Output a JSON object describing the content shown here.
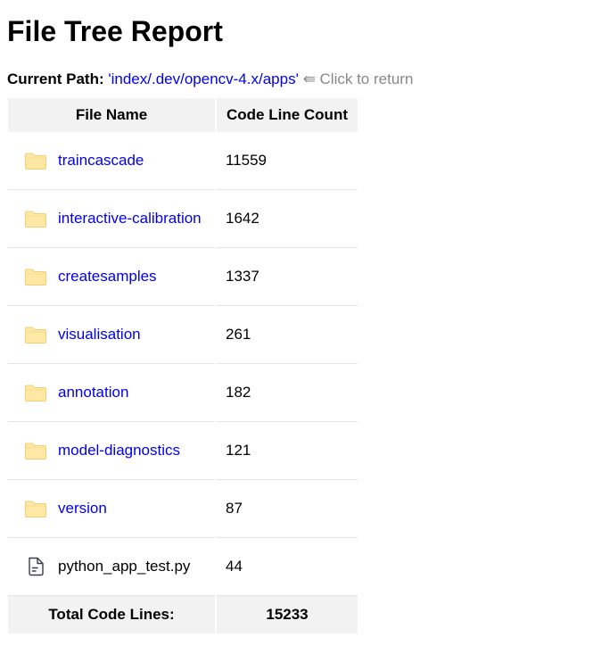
{
  "title": "File Tree Report",
  "current_path": {
    "label": "Current Path:",
    "path": "'index/.dev/opencv-4.x/apps'",
    "return_text": "⇚ Click to return"
  },
  "table": {
    "headers": {
      "name": "File Name",
      "count": "Code Line Count"
    },
    "rows": [
      {
        "icon": "folder-icon",
        "name": "traincascade",
        "count": "11559",
        "is_link": true
      },
      {
        "icon": "folder-icon",
        "name": "interactive-calibration",
        "count": "1642",
        "is_link": true
      },
      {
        "icon": "folder-icon",
        "name": "createsamples",
        "count": "1337",
        "is_link": true
      },
      {
        "icon": "folder-icon",
        "name": "visualisation",
        "count": "261",
        "is_link": true
      },
      {
        "icon": "folder-icon",
        "name": "annotation",
        "count": "182",
        "is_link": true
      },
      {
        "icon": "folder-icon",
        "name": "model-diagnostics",
        "count": "121",
        "is_link": true
      },
      {
        "icon": "folder-icon",
        "name": "version",
        "count": "87",
        "is_link": true
      },
      {
        "icon": "file-icon",
        "name": "python_app_test.py",
        "count": "44",
        "is_link": false
      }
    ],
    "footer": {
      "label": "Total Code Lines:",
      "total": "15233"
    }
  },
  "colors": {
    "link": "#0000ee",
    "return_text": "#888888",
    "header_bg": "#f2f2f2",
    "folder_fill": "#fde8a6"
  }
}
